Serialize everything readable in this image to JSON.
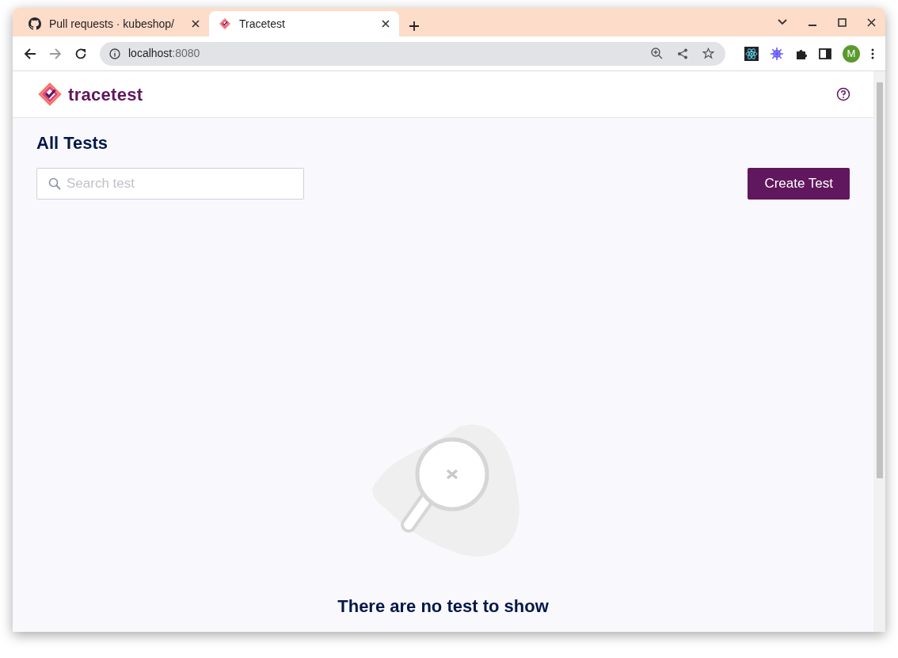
{
  "browser": {
    "tabs": [
      {
        "title": "Pull requests · kubeshop/",
        "selected": false,
        "kind": "github"
      },
      {
        "title": "Tracetest",
        "selected": true,
        "kind": "app"
      }
    ],
    "address": {
      "host": "localhost",
      "port": ":8080"
    },
    "profile_initial": "M"
  },
  "header": {
    "brand": "tracetest"
  },
  "page": {
    "title": "All Tests",
    "search": {
      "placeholder": "Search test"
    },
    "create_button": "Create Test",
    "empty_state": {
      "title": "There are no test to show"
    }
  }
}
